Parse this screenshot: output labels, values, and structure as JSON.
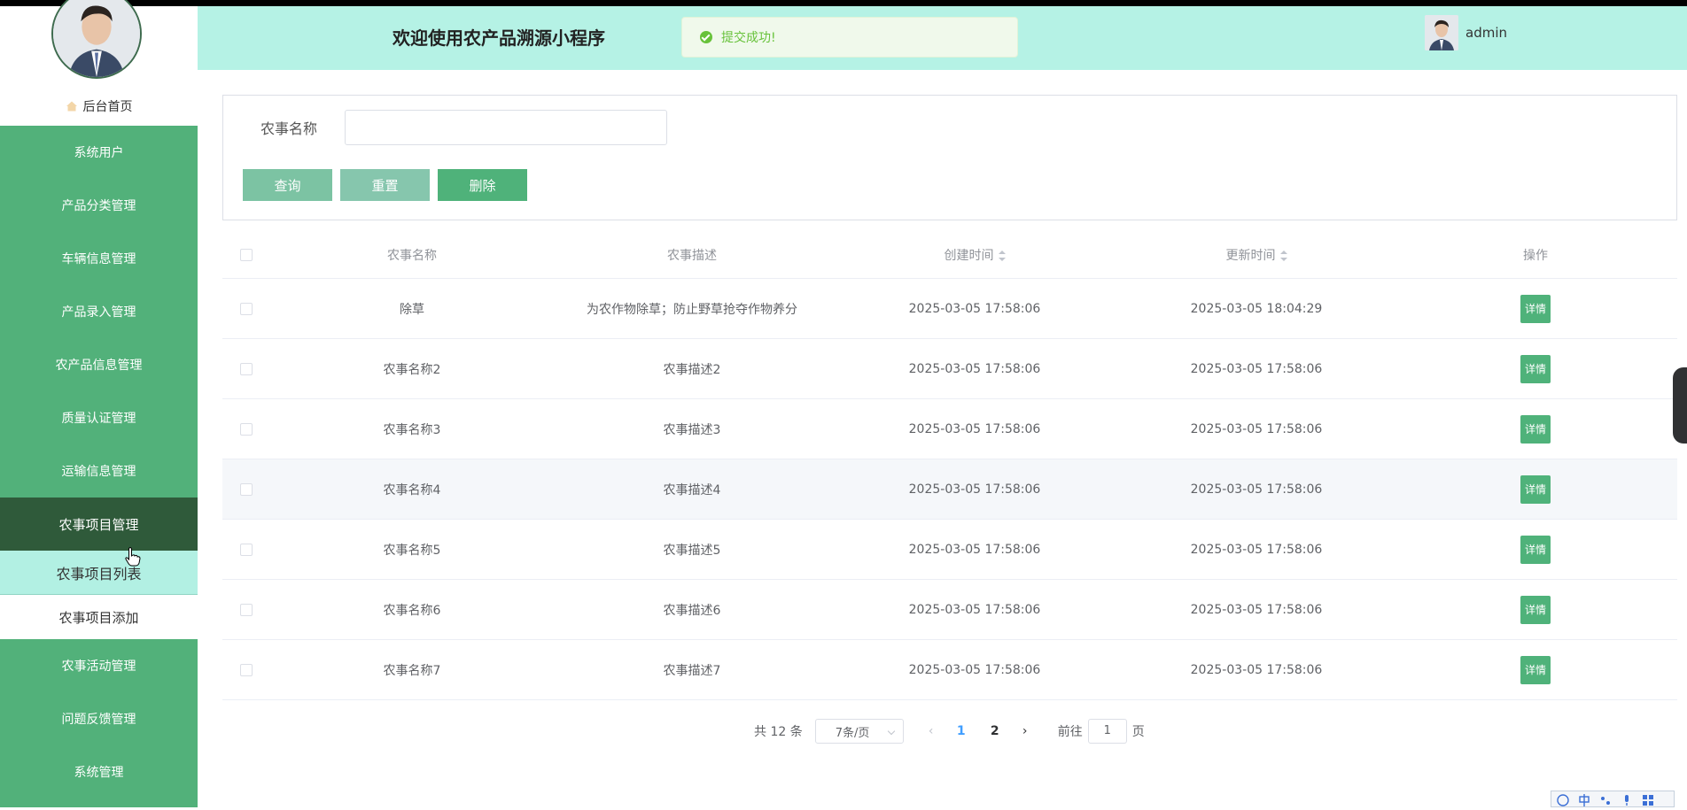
{
  "header": {
    "title": "欢迎使用农产品溯源小程序",
    "toast": "提交成功!",
    "username": "admin"
  },
  "sidebar": {
    "home": "后台首页",
    "items": [
      {
        "label": "系统用户"
      },
      {
        "label": "产品分类管理"
      },
      {
        "label": "车辆信息管理"
      },
      {
        "label": "产品录入管理"
      },
      {
        "label": "农产品信息管理"
      },
      {
        "label": "质量认证管理"
      },
      {
        "label": "运输信息管理"
      },
      {
        "label": "农事项目管理"
      }
    ],
    "sub_items": [
      {
        "label": "农事项目列表"
      },
      {
        "label": "农事项目添加"
      }
    ],
    "items_after": [
      {
        "label": "农事活动管理"
      },
      {
        "label": "问题反馈管理"
      },
      {
        "label": "系统管理"
      }
    ]
  },
  "search": {
    "label": "农事名称",
    "value": "",
    "query_label": "查询",
    "reset_label": "重置",
    "delete_label": "删除"
  },
  "table": {
    "headers": {
      "name": "农事名称",
      "desc": "农事描述",
      "created": "创建时间",
      "updated": "更新时间",
      "op": "操作"
    },
    "detail_label": "详情",
    "rows": [
      {
        "name": "除草",
        "desc": "为农作物除草；防止野草抢夺作物养分",
        "created": "2025-03-05 17:58:06",
        "updated": "2025-03-05 18:04:29"
      },
      {
        "name": "农事名称2",
        "desc": "农事描述2",
        "created": "2025-03-05 17:58:06",
        "updated": "2025-03-05 17:58:06"
      },
      {
        "name": "农事名称3",
        "desc": "农事描述3",
        "created": "2025-03-05 17:58:06",
        "updated": "2025-03-05 17:58:06"
      },
      {
        "name": "农事名称4",
        "desc": "农事描述4",
        "created": "2025-03-05 17:58:06",
        "updated": "2025-03-05 17:58:06"
      },
      {
        "name": "农事名称5",
        "desc": "农事描述5",
        "created": "2025-03-05 17:58:06",
        "updated": "2025-03-05 17:58:06"
      },
      {
        "name": "农事名称6",
        "desc": "农事描述6",
        "created": "2025-03-05 17:58:06",
        "updated": "2025-03-05 17:58:06"
      },
      {
        "name": "农事名称7",
        "desc": "农事描述7",
        "created": "2025-03-05 17:58:06",
        "updated": "2025-03-05 17:58:06"
      }
    ]
  },
  "pagination": {
    "total": "共 12 条",
    "page_size": "7条/页",
    "pages": [
      "1",
      "2"
    ],
    "current": "1",
    "goto_prefix": "前往",
    "goto_value": "1",
    "goto_suffix": "页"
  },
  "colors": {
    "sidebar": "#52b17a",
    "sidebar_active": "#2f5a3a",
    "header": "#b5f2e5",
    "primary_button": "#4fb27a",
    "success": "#67c23a",
    "page_current": "#409eff"
  }
}
